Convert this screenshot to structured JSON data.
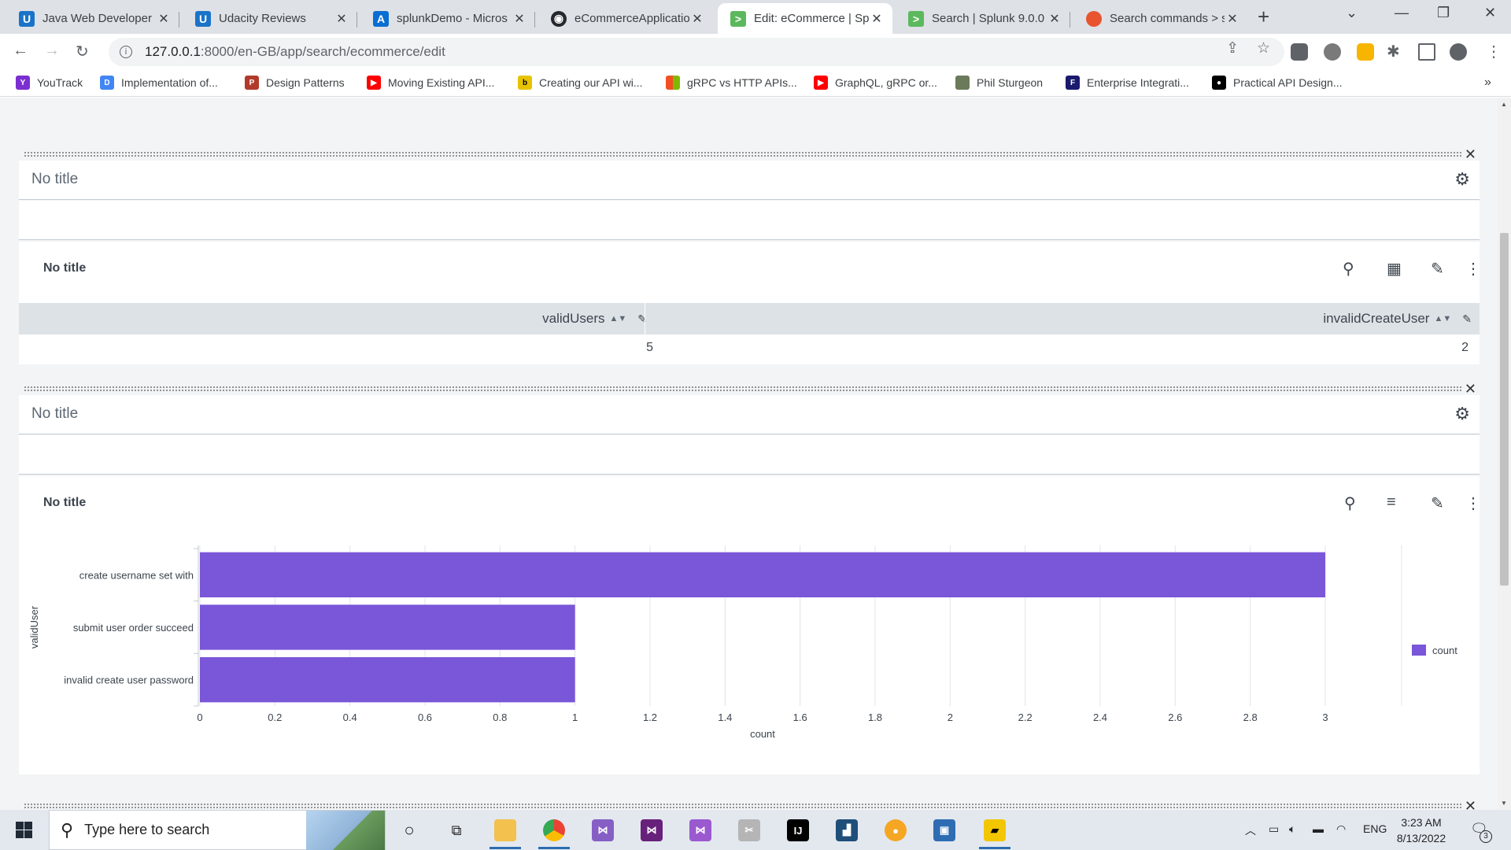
{
  "browser": {
    "tabs": [
      {
        "label": "Java Web Developer N",
        "icon": "udacity-icon",
        "active": false
      },
      {
        "label": "Udacity Reviews",
        "icon": "udacity-icon",
        "active": false
      },
      {
        "label": "splunkDemo - Micros",
        "icon": "azure-icon",
        "active": false
      },
      {
        "label": "eCommerceApplicatio",
        "icon": "github-icon",
        "active": false
      },
      {
        "label": "Edit: eCommerce | Sp",
        "icon": "splunk-icon",
        "active": true
      },
      {
        "label": "Search | Splunk 9.0.0",
        "icon": "splunk-icon",
        "active": false
      },
      {
        "label": "Search commands > s",
        "icon": "splunk-docs-icon",
        "active": false
      }
    ],
    "address": {
      "url_host": "127.0.0.1",
      "url_rest": ":8000/en-GB/app/search/ecommerce/edit"
    },
    "bookmarks": [
      {
        "label": "YouTrack",
        "icon": "youtrack-icon",
        "color": "#7b2fd1"
      },
      {
        "label": "Implementation of...",
        "icon": "docs-icon",
        "color": "#4285f4"
      },
      {
        "label": "Design Patterns",
        "icon": "design-patterns-icon",
        "color": "#b23a2a"
      },
      {
        "label": "Moving Existing API...",
        "icon": "youtube-icon",
        "color": "#ff0000"
      },
      {
        "label": "Creating our API wi...",
        "icon": "baeldung-icon",
        "color": "#e6c300"
      },
      {
        "label": "gRPC vs HTTP APIs...",
        "icon": "microsoft-icon",
        "color": "#f25022"
      },
      {
        "label": "GraphQL, gRPC or...",
        "icon": "youtube-icon",
        "color": "#ff0000"
      },
      {
        "label": "Phil Sturgeon",
        "icon": "phil-sturgeon-icon",
        "color": "#6b7a5a"
      },
      {
        "label": "Enterprise Integrati...",
        "icon": "enterprise-icon",
        "color": "#1a1a6e"
      },
      {
        "label": "Practical API Design...",
        "icon": "medium-icon",
        "color": "#000000"
      }
    ]
  },
  "dashboard": {
    "row1": {
      "title_placeholder": "No title",
      "panel": {
        "title": "No title",
        "table": {
          "columns": [
            "validUsers",
            "invalidCreateUser"
          ],
          "rows": [
            [
              "5",
              "2"
            ]
          ]
        }
      }
    },
    "row2": {
      "title_placeholder": "No title",
      "panel": {
        "title": "No title"
      }
    }
  },
  "chart_data": {
    "type": "bar",
    "orientation": "horizontal",
    "categories": [
      "create username set with",
      "submit user order succeed",
      "invalid create user password"
    ],
    "series": [
      {
        "name": "count",
        "values": [
          3,
          1,
          1
        ],
        "color": "#7a56d9"
      }
    ],
    "xlabel": "count",
    "ylabel": "validUser",
    "xlim": [
      0,
      3
    ],
    "xticks": [
      "0",
      "0.2",
      "0.4",
      "0.6",
      "0.8",
      "1",
      "1.2",
      "1.4",
      "1.6",
      "1.8",
      "2",
      "2.2",
      "2.4",
      "2.6",
      "2.8",
      "3"
    ],
    "grid": true,
    "legend": "right"
  },
  "taskbar": {
    "search_placeholder": "Type here to search",
    "language": "ENG",
    "time": "3:23 AM",
    "date": "8/13/2022",
    "notification_count": "3"
  }
}
